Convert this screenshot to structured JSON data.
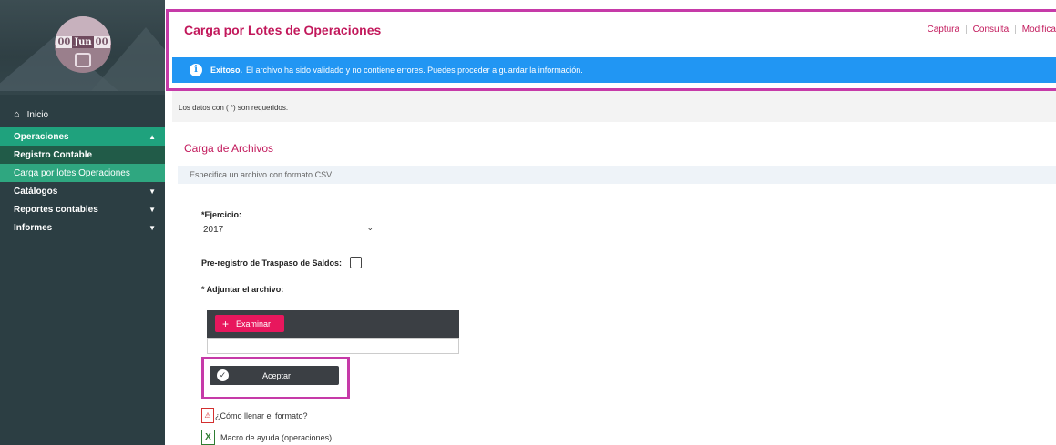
{
  "logo": {
    "date_parts": [
      "00",
      "Jun",
      "00"
    ]
  },
  "sidebar": {
    "inicio": "Inicio",
    "items": [
      {
        "label": "Operaciones",
        "chevron": "chevron-up",
        "active": true
      },
      {
        "label": "Catálogos",
        "chevron": "chevron-down"
      },
      {
        "label": "Reportes contables",
        "chevron": "chevron-down"
      },
      {
        "label": "Informes",
        "chevron": "chevron-down"
      }
    ],
    "subitems": [
      {
        "label": "Registro Contable"
      },
      {
        "label": "Carga por lotes Operaciones",
        "selected": true
      }
    ]
  },
  "header": {
    "title": "Carga por Lotes de Operaciones",
    "links": [
      "Captura",
      "Consulta",
      "Modifica"
    ]
  },
  "alert": {
    "strong": "Exitoso.",
    "message": "El archivo ha sido validado y no contiene errores. Puedes proceder a guardar la información."
  },
  "required_note": "Los datos con ( *) son requeridos.",
  "section": {
    "title": "Carga de Archivos",
    "subheader": "Especifica un archivo con formato CSV"
  },
  "form": {
    "ejercicio_label": "*Ejercicio:",
    "ejercicio_value": "2017",
    "preregistro_label": "Pre-registro de Traspaso de Saldos:",
    "adjuntar_label": "* Adjuntar el archivo:",
    "examinar_label": "Examinar",
    "aceptar_label": "Aceptar"
  },
  "links": {
    "como_llenar": "¿Cómo llenar el formato?",
    "macro": "Macro de ayuda (operaciones)"
  },
  "colors": {
    "accent": "#c2185b",
    "sidebar_bg": "#2c3e43",
    "sidebar_active": "#1fa27d",
    "alert_bg": "#2196f3",
    "highlight": "#c63aa8"
  }
}
